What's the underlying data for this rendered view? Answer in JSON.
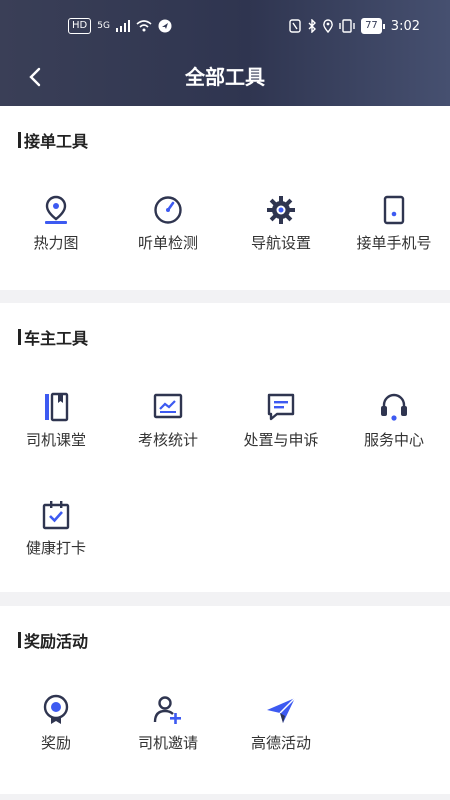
{
  "status": {
    "network": "5G",
    "battery": "77",
    "time": "3:02",
    "hd": "HD"
  },
  "header": {
    "title": "全部工具"
  },
  "sections": [
    {
      "title": "接单工具",
      "items": [
        {
          "label": "热力图",
          "icon": "location-pin-icon"
        },
        {
          "label": "听单检测",
          "icon": "gauge-icon"
        },
        {
          "label": "导航设置",
          "icon": "gear-icon"
        },
        {
          "label": "接单手机号",
          "icon": "phone-icon"
        }
      ]
    },
    {
      "title": "车主工具",
      "items": [
        {
          "label": "司机课堂",
          "icon": "book-icon"
        },
        {
          "label": "考核统计",
          "icon": "chart-icon"
        },
        {
          "label": "处置与申诉",
          "icon": "message-icon"
        },
        {
          "label": "服务中心",
          "icon": "headset-icon"
        },
        {
          "label": "健康打卡",
          "icon": "calendar-check-icon"
        }
      ]
    },
    {
      "title": "奖励活动",
      "items": [
        {
          "label": "奖励",
          "icon": "medal-icon"
        },
        {
          "label": "司机邀请",
          "icon": "add-user-icon"
        },
        {
          "label": "高德活动",
          "icon": "paper-plane-icon"
        }
      ]
    }
  ],
  "colors": {
    "accent": "#3d5af1",
    "icon": "#2f3550",
    "header": "#333a55"
  }
}
